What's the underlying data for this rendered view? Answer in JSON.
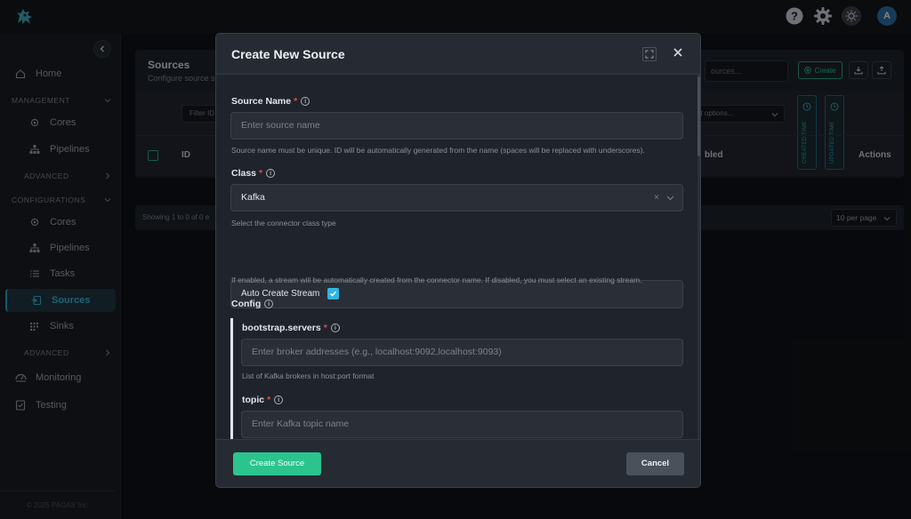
{
  "topbar": {
    "icons": [
      "help-icon",
      "settings-icon",
      "theme-toggle-icon"
    ],
    "avatar_initial": "A"
  },
  "sidebar": {
    "home": "Home",
    "management": {
      "title": "MANAGEMENT",
      "items": [
        "Cores",
        "Pipelines"
      ],
      "advanced": "ADVANCED"
    },
    "configurations": {
      "title": "CONFIGURATIONS",
      "items": [
        "Cores",
        "Pipelines",
        "Tasks",
        "Sources",
        "Sinks"
      ],
      "advanced": "ADVANCED"
    },
    "monitoring": "Monitoring",
    "testing": "Testing",
    "footer": "© 2025 PAGAS Inc."
  },
  "page": {
    "title": "Sources",
    "subtitle": "Configure source s",
    "search_placeholder": "ources...",
    "create_label": "Create",
    "filter_placeholder": "Filter ID",
    "select_placeholder": "ect options...",
    "created_time": "CREATED TIME",
    "updated_time": "UPDATED TIME",
    "col_id": "ID",
    "col_enabled": "bled",
    "col_actions": "Actions",
    "showing": "Showing 1 to 0 of 0 e",
    "per_page": "10 per page"
  },
  "modal": {
    "title": "Create New Source",
    "source_name": {
      "label": "Source Name",
      "placeholder": "Enter source name",
      "help": "Source name must be unique. ID will be automatically generated from the name (spaces will be replaced with underscores)."
    },
    "class": {
      "label": "Class",
      "value": "Kafka",
      "help": "Select the connector class type"
    },
    "auto_create_stream": {
      "label": "Auto Create Stream",
      "checked": true,
      "help": "If enabled, a stream will be automatically created from the connector name. If disabled, you must select an existing stream."
    },
    "config": {
      "label": "Config",
      "bootstrap_servers": {
        "label": "bootstrap.servers",
        "placeholder": "Enter broker addresses (e.g., localhost:9092,localhost:9093)",
        "help": "List of Kafka brokers in host:port format"
      },
      "topic": {
        "label": "topic",
        "placeholder": "Enter Kafka topic name"
      }
    },
    "create_button": "Create Source",
    "cancel_button": "Cancel"
  },
  "colors": {
    "accent": "#2fb6e0",
    "primary_button": "#2bc48e",
    "required": "#e5484d"
  }
}
